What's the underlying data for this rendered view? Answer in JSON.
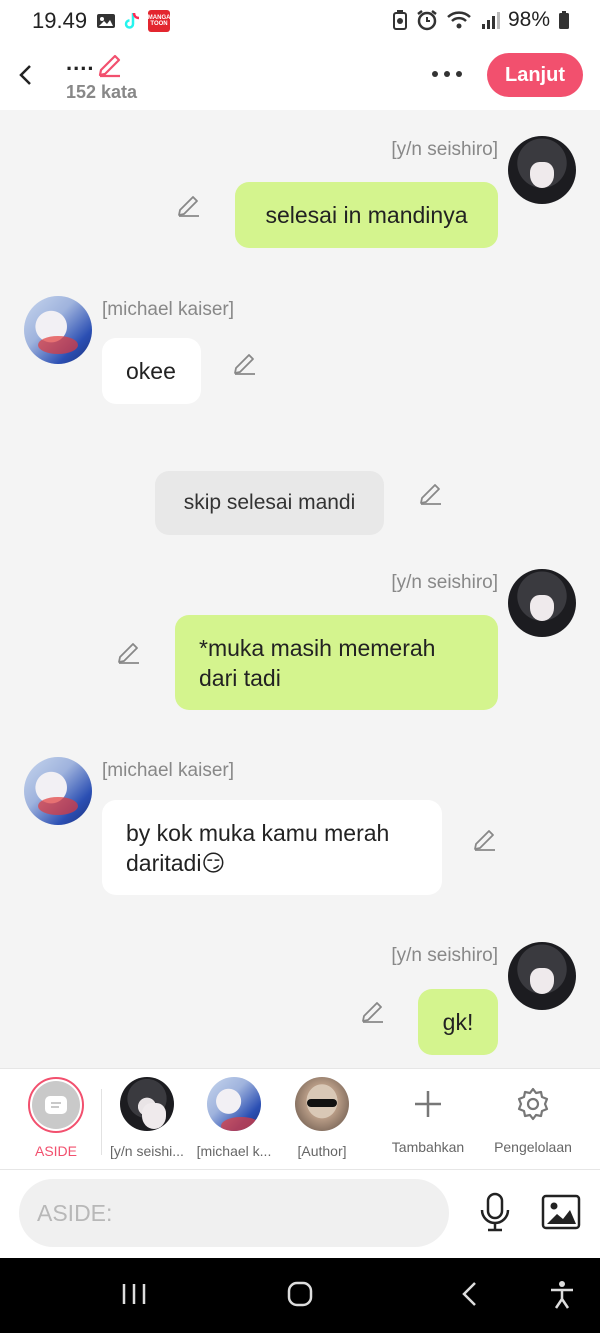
{
  "status": {
    "time": "19.49",
    "manga_label": "MANGA TOON",
    "battery": "98%"
  },
  "header": {
    "title": "....",
    "word_count": "152 kata",
    "next_button": "Lanjut"
  },
  "messages": [
    {
      "type": "right",
      "name": "[y/n seishiro]",
      "text": "selesai in mandinya"
    },
    {
      "type": "left",
      "name": "[michael kaiser]",
      "text": "okee"
    },
    {
      "type": "aside",
      "text": "skip selesai mandi"
    },
    {
      "type": "right",
      "name": "[y/n seishiro]",
      "text": "*muka masih memerah dari tadi"
    },
    {
      "type": "left",
      "name": "[michael kaiser]",
      "text": "by kok muka kamu merah daritadi😏"
    },
    {
      "type": "right",
      "name": "[y/n seishiro]",
      "text": "gk!"
    }
  ],
  "characters": [
    {
      "label": "ASIDE"
    },
    {
      "label": "[y/n seishi..."
    },
    {
      "label": "[michael k..."
    },
    {
      "label": "[Author]"
    }
  ],
  "tools": {
    "add": "Tambahkan",
    "manage": "Pengelolaan"
  },
  "input": {
    "placeholder": "ASIDE:"
  },
  "colors": {
    "accent": "#f2506e",
    "bubble_green": "#d4f48e",
    "bubble_white": "#ffffff",
    "aside_grey": "#e8e8e8"
  }
}
